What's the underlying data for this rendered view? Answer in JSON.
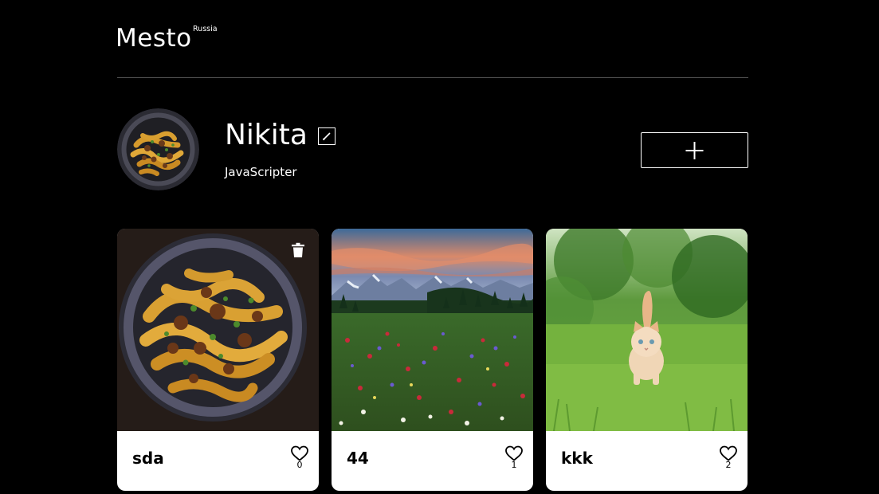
{
  "header": {
    "logo": "Mesto",
    "logo_superscript": "Russia"
  },
  "profile": {
    "name": "Nikita",
    "about": "JavaScripter",
    "avatar_icon": "pasta-avatar",
    "edit_icon": "pencil-icon",
    "add_icon": "plus-icon"
  },
  "cards": [
    {
      "title": "sda",
      "likes": "0",
      "deletable": true,
      "image": "pasta-bowl-photo"
    },
    {
      "title": "44",
      "likes": "1",
      "deletable": false,
      "image": "mountain-meadow-photo"
    },
    {
      "title": "kkk",
      "likes": "2",
      "deletable": false,
      "image": "kitten-in-grass-photo"
    }
  ],
  "colors": {
    "background": "#000000",
    "card": "#ffffff",
    "divider": "#545454",
    "text_light": "#ffffff",
    "text_dark": "#000000"
  }
}
